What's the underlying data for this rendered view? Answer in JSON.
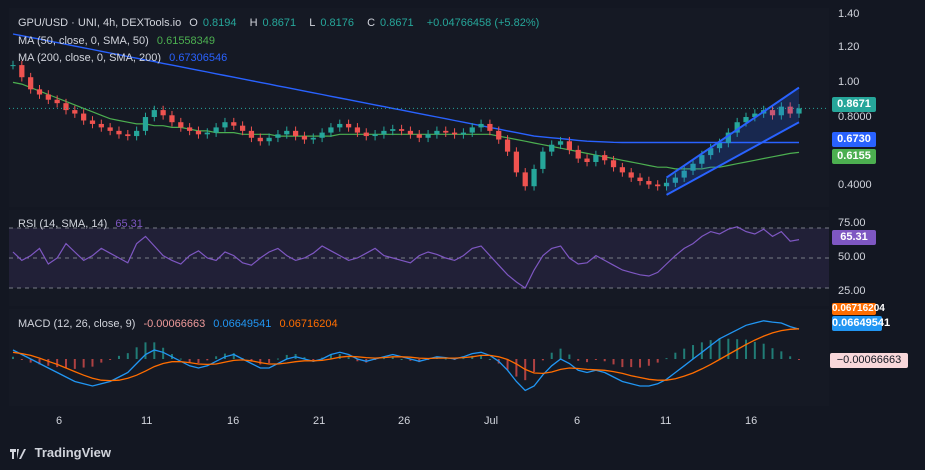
{
  "header": {
    "symbol": "GPU/USD · UNI, 4h, DEXTools.io",
    "o_label": "O",
    "o_val": "0.8194",
    "h_label": "H",
    "h_val": "0.8671",
    "l_label": "L",
    "l_val": "0.8176",
    "c_label": "C",
    "c_val": "0.8671",
    "change": "+0.04766458 (+5.82%)"
  },
  "ma50": {
    "label": "MA (50, close, 0, SMA, 50)",
    "value": "0.61558349",
    "color": "#4caf50"
  },
  "ma200": {
    "label": "MA (200, close, 0, SMA, 200)",
    "value": "0.67306546",
    "color": "#2962ff"
  },
  "rsi": {
    "label": "RSI (14, SMA, 14)",
    "value": "65.31",
    "color": "#7e57c2"
  },
  "macd": {
    "label": "MACD (12, 26, close, 9)",
    "hist_val": "-0.00066663",
    "macd_val": "0.06649541",
    "signal_val": "0.06716204"
  },
  "badges": {
    "price": "0.8671",
    "ma200": "0.6730",
    "ma50": "0.6155",
    "rsi": "65.31",
    "macd": "0.06649541",
    "signal": "0.06716204",
    "hist": "−0.00066663"
  },
  "price_axis": [
    "1.40",
    "1.20",
    "1.00",
    "0.8000",
    "0.4000"
  ],
  "rsi_axis": [
    "75.00",
    "50.00",
    "25.00"
  ],
  "dates": [
    "6",
    "11",
    "16",
    "21",
    "26",
    "Jul",
    "6",
    "11",
    "16"
  ],
  "brand": "TradingView",
  "colors": {
    "up": "#26a69a",
    "down": "#ef5350",
    "ma50": "#4caf50",
    "ma200": "#2962ff",
    "rsi": "#7e57c2",
    "macd": "#2196f3",
    "signal": "#ff6d00",
    "channel": "#2962ff"
  },
  "chart_data": {
    "type": "line",
    "ylim": [
      0.3,
      1.45
    ],
    "price_close": [
      1.12,
      1.05,
      0.98,
      0.95,
      0.92,
      0.9,
      0.86,
      0.84,
      0.8,
      0.78,
      0.76,
      0.74,
      0.72,
      0.71,
      0.74,
      0.82,
      0.86,
      0.83,
      0.79,
      0.76,
      0.74,
      0.72,
      0.73,
      0.76,
      0.79,
      0.77,
      0.74,
      0.7,
      0.68,
      0.7,
      0.72,
      0.74,
      0.71,
      0.69,
      0.7,
      0.73,
      0.76,
      0.78,
      0.76,
      0.73,
      0.71,
      0.72,
      0.74,
      0.75,
      0.74,
      0.72,
      0.7,
      0.72,
      0.74,
      0.73,
      0.72,
      0.73,
      0.76,
      0.78,
      0.74,
      0.69,
      0.62,
      0.5,
      0.42,
      0.52,
      0.62,
      0.66,
      0.68,
      0.63,
      0.58,
      0.56,
      0.6,
      0.57,
      0.53,
      0.5,
      0.47,
      0.45,
      0.43,
      0.42,
      0.44,
      0.47,
      0.51,
      0.55,
      0.6,
      0.64,
      0.67,
      0.73,
      0.79,
      0.82,
      0.84,
      0.86,
      0.83,
      0.88,
      0.84,
      0.87
    ],
    "ma50": [
      1.02,
      1.01,
      0.99,
      0.97,
      0.95,
      0.93,
      0.91,
      0.89,
      0.87,
      0.85,
      0.83,
      0.81,
      0.8,
      0.79,
      0.78,
      0.78,
      0.77,
      0.77,
      0.76,
      0.76,
      0.75,
      0.74,
      0.74,
      0.73,
      0.73,
      0.73,
      0.72,
      0.72,
      0.72,
      0.72,
      0.71,
      0.71,
      0.71,
      0.71,
      0.71,
      0.71,
      0.71,
      0.72,
      0.72,
      0.72,
      0.72,
      0.72,
      0.72,
      0.72,
      0.72,
      0.72,
      0.72,
      0.72,
      0.72,
      0.72,
      0.72,
      0.72,
      0.72,
      0.72,
      0.72,
      0.71,
      0.7,
      0.69,
      0.68,
      0.67,
      0.66,
      0.65,
      0.64,
      0.63,
      0.62,
      0.61,
      0.6,
      0.59,
      0.58,
      0.57,
      0.56,
      0.55,
      0.54,
      0.53,
      0.53,
      0.52,
      0.52,
      0.52,
      0.52,
      0.53,
      0.53,
      0.54,
      0.55,
      0.56,
      0.57,
      0.58,
      0.59,
      0.6,
      0.61,
      0.6155
    ],
    "ma200": [
      1.3,
      1.29,
      1.28,
      1.27,
      1.26,
      1.25,
      1.24,
      1.23,
      1.22,
      1.21,
      1.2,
      1.19,
      1.18,
      1.17,
      1.16,
      1.15,
      1.14,
      1.13,
      1.12,
      1.11,
      1.1,
      1.09,
      1.08,
      1.07,
      1.06,
      1.05,
      1.04,
      1.03,
      1.02,
      1.01,
      1.0,
      0.99,
      0.98,
      0.97,
      0.96,
      0.95,
      0.94,
      0.93,
      0.92,
      0.91,
      0.9,
      0.89,
      0.88,
      0.87,
      0.86,
      0.85,
      0.84,
      0.83,
      0.82,
      0.81,
      0.8,
      0.79,
      0.78,
      0.77,
      0.76,
      0.75,
      0.74,
      0.73,
      0.72,
      0.71,
      0.705,
      0.7,
      0.695,
      0.69,
      0.685,
      0.68,
      0.678,
      0.676,
      0.674,
      0.673,
      0.673,
      0.673,
      0.673,
      0.673,
      0.673,
      0.673,
      0.673,
      0.673,
      0.673,
      0.673,
      0.673,
      0.673,
      0.673,
      0.673,
      0.673,
      0.673,
      0.673,
      0.673,
      0.673,
      0.673
    ],
    "rsi": [
      55,
      48,
      52,
      58,
      45,
      50,
      62,
      55,
      48,
      52,
      58,
      54,
      50,
      46,
      62,
      68,
      60,
      52,
      48,
      45,
      52,
      56,
      50,
      48,
      55,
      52,
      46,
      44,
      50,
      55,
      58,
      52,
      48,
      50,
      54,
      60,
      56,
      52,
      48,
      50,
      54,
      58,
      52,
      50,
      48,
      46,
      52,
      55,
      53,
      50,
      48,
      52,
      58,
      60,
      52,
      44,
      36,
      30,
      25,
      40,
      52,
      58,
      60,
      50,
      45,
      46,
      52,
      48,
      44,
      40,
      38,
      36,
      35,
      38,
      45,
      52,
      58,
      62,
      68,
      72,
      70,
      74,
      76,
      72,
      70,
      74,
      68,
      72,
      64,
      65.31
    ],
    "macd": [
      0.02,
      0.01,
      0.0,
      -0.01,
      -0.02,
      -0.03,
      -0.04,
      -0.05,
      -0.055,
      -0.06,
      -0.055,
      -0.05,
      -0.04,
      -0.03,
      -0.01,
      0.01,
      0.02,
      0.015,
      0.005,
      -0.005,
      -0.015,
      -0.02,
      -0.015,
      -0.005,
      0.005,
      0.01,
      0.0,
      -0.01,
      -0.02,
      -0.02,
      -0.01,
      0.0,
      0.005,
      0.0,
      -0.005,
      0.0,
      0.01,
      0.015,
      0.01,
      0.0,
      -0.005,
      0.0,
      0.005,
      0.01,
      0.005,
      0.0,
      -0.005,
      0.0,
      0.005,
      0.003,
      0.0,
      0.005,
      0.012,
      0.015,
      0.008,
      -0.005,
      -0.025,
      -0.05,
      -0.07,
      -0.06,
      -0.035,
      -0.015,
      0.0,
      -0.01,
      -0.025,
      -0.03,
      -0.025,
      -0.03,
      -0.04,
      -0.05,
      -0.055,
      -0.06,
      -0.06,
      -0.055,
      -0.045,
      -0.03,
      -0.015,
      0.0,
      0.015,
      0.03,
      0.045,
      0.055,
      0.065,
      0.075,
      0.08,
      0.085,
      0.082,
      0.08,
      0.072,
      0.0665
    ],
    "signal": [
      0.015,
      0.012,
      0.008,
      0.002,
      -0.005,
      -0.012,
      -0.02,
      -0.028,
      -0.036,
      -0.043,
      -0.047,
      -0.048,
      -0.047,
      -0.043,
      -0.036,
      -0.027,
      -0.017,
      -0.01,
      -0.006,
      -0.006,
      -0.008,
      -0.011,
      -0.012,
      -0.011,
      -0.007,
      -0.003,
      -0.002,
      -0.004,
      -0.008,
      -0.011,
      -0.011,
      -0.009,
      -0.006,
      -0.004,
      -0.004,
      -0.003,
      0.0,
      0.004,
      0.006,
      0.005,
      0.003,
      0.002,
      0.003,
      0.005,
      0.005,
      0.004,
      0.002,
      0.001,
      0.002,
      0.002,
      0.002,
      0.003,
      0.005,
      0.008,
      0.008,
      0.005,
      -0.001,
      -0.011,
      -0.023,
      -0.031,
      -0.032,
      -0.029,
      -0.023,
      -0.02,
      -0.021,
      -0.023,
      -0.024,
      -0.025,
      -0.028,
      -0.032,
      -0.037,
      -0.041,
      -0.045,
      -0.047,
      -0.047,
      -0.044,
      -0.038,
      -0.031,
      -0.022,
      -0.012,
      -0.001,
      0.01,
      0.021,
      0.032,
      0.042,
      0.051,
      0.058,
      0.063,
      0.066,
      0.0672
    ]
  }
}
